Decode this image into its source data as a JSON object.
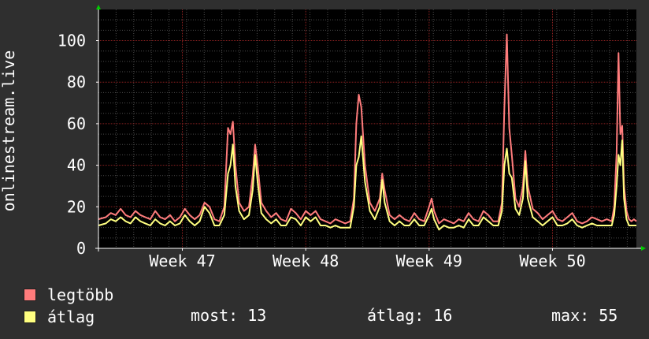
{
  "chart_data": {
    "type": "line",
    "ylabel": "onlinestream.live",
    "ylim": [
      0,
      115
    ],
    "yticks": [
      0,
      20,
      40,
      60,
      80,
      100
    ],
    "xlim": [
      46.32,
      50.68
    ],
    "xticks": [
      {
        "label": "Week 47",
        "x": 47
      },
      {
        "label": "Week 48",
        "x": 48
      },
      {
        "label": "Week 49",
        "x": 49
      },
      {
        "label": "Week 50",
        "x": 50
      }
    ],
    "grid": true,
    "series": [
      {
        "name": "legtöbb",
        "color": "#ff7c7c",
        "points": [
          [
            46.32,
            14
          ],
          [
            46.38,
            15
          ],
          [
            46.42,
            17
          ],
          [
            46.46,
            16
          ],
          [
            46.5,
            19
          ],
          [
            46.54,
            16
          ],
          [
            46.58,
            15
          ],
          [
            46.62,
            18
          ],
          [
            46.66,
            16
          ],
          [
            46.7,
            15
          ],
          [
            46.74,
            14
          ],
          [
            46.78,
            18
          ],
          [
            46.82,
            15
          ],
          [
            46.86,
            14
          ],
          [
            46.9,
            16
          ],
          [
            46.94,
            13
          ],
          [
            46.98,
            15
          ],
          [
            47.02,
            19
          ],
          [
            47.06,
            16
          ],
          [
            47.1,
            14
          ],
          [
            47.14,
            16
          ],
          [
            47.18,
            22
          ],
          [
            47.22,
            20
          ],
          [
            47.26,
            14
          ],
          [
            47.3,
            13
          ],
          [
            47.34,
            20
          ],
          [
            47.37,
            58
          ],
          [
            47.39,
            55
          ],
          [
            47.41,
            61
          ],
          [
            47.43,
            40
          ],
          [
            47.46,
            22
          ],
          [
            47.5,
            18
          ],
          [
            47.54,
            20
          ],
          [
            47.57,
            35
          ],
          [
            47.59,
            50
          ],
          [
            47.61,
            40
          ],
          [
            47.64,
            22
          ],
          [
            47.68,
            18
          ],
          [
            47.72,
            15
          ],
          [
            47.76,
            17
          ],
          [
            47.8,
            14
          ],
          [
            47.84,
            13
          ],
          [
            47.88,
            19
          ],
          [
            47.92,
            17
          ],
          [
            47.96,
            14
          ],
          [
            48.0,
            18
          ],
          [
            48.04,
            16
          ],
          [
            48.08,
            18
          ],
          [
            48.12,
            14
          ],
          [
            48.16,
            13
          ],
          [
            48.2,
            12
          ],
          [
            48.24,
            14
          ],
          [
            48.28,
            13
          ],
          [
            48.32,
            12
          ],
          [
            48.36,
            13
          ],
          [
            48.39,
            24
          ],
          [
            48.41,
            60
          ],
          [
            48.43,
            74
          ],
          [
            48.45,
            68
          ],
          [
            48.48,
            40
          ],
          [
            48.52,
            22
          ],
          [
            48.56,
            18
          ],
          [
            48.6,
            24
          ],
          [
            48.62,
            36
          ],
          [
            48.64,
            28
          ],
          [
            48.68,
            16
          ],
          [
            48.72,
            14
          ],
          [
            48.76,
            16
          ],
          [
            48.8,
            14
          ],
          [
            48.84,
            13
          ],
          [
            48.88,
            17
          ],
          [
            48.92,
            14
          ],
          [
            48.96,
            13
          ],
          [
            49.0,
            20
          ],
          [
            49.02,
            24
          ],
          [
            49.04,
            18
          ],
          [
            49.08,
            12
          ],
          [
            49.12,
            14
          ],
          [
            49.16,
            13
          ],
          [
            49.2,
            12
          ],
          [
            49.24,
            14
          ],
          [
            49.28,
            13
          ],
          [
            49.32,
            17
          ],
          [
            49.36,
            14
          ],
          [
            49.4,
            13
          ],
          [
            49.44,
            18
          ],
          [
            49.48,
            16
          ],
          [
            49.52,
            13
          ],
          [
            49.56,
            13
          ],
          [
            49.59,
            22
          ],
          [
            49.61,
            68
          ],
          [
            49.63,
            103
          ],
          [
            49.65,
            58
          ],
          [
            49.67,
            45
          ],
          [
            49.7,
            24
          ],
          [
            49.73,
            20
          ],
          [
            49.76,
            30
          ],
          [
            49.78,
            47
          ],
          [
            49.8,
            30
          ],
          [
            49.84,
            19
          ],
          [
            49.88,
            17
          ],
          [
            49.92,
            14
          ],
          [
            49.96,
            16
          ],
          [
            50.0,
            18
          ],
          [
            50.04,
            14
          ],
          [
            50.08,
            13
          ],
          [
            50.12,
            15
          ],
          [
            50.16,
            17
          ],
          [
            50.2,
            13
          ],
          [
            50.24,
            12
          ],
          [
            50.28,
            13
          ],
          [
            50.32,
            15
          ],
          [
            50.36,
            14
          ],
          [
            50.4,
            13
          ],
          [
            50.44,
            14
          ],
          [
            50.48,
            13
          ],
          [
            50.5,
            20
          ],
          [
            50.52,
            46
          ],
          [
            50.535,
            94
          ],
          [
            50.55,
            55
          ],
          [
            50.565,
            59
          ],
          [
            50.58,
            30
          ],
          [
            50.6,
            18
          ],
          [
            50.62,
            14
          ],
          [
            50.64,
            13
          ],
          [
            50.66,
            14
          ],
          [
            50.68,
            13
          ]
        ]
      },
      {
        "name": "átlag",
        "color": "#ffff80",
        "points": [
          [
            46.32,
            11
          ],
          [
            46.38,
            12
          ],
          [
            46.42,
            14
          ],
          [
            46.46,
            13
          ],
          [
            46.5,
            15
          ],
          [
            46.54,
            13
          ],
          [
            46.58,
            12
          ],
          [
            46.62,
            15
          ],
          [
            46.66,
            13
          ],
          [
            46.7,
            12
          ],
          [
            46.74,
            11
          ],
          [
            46.78,
            14
          ],
          [
            46.82,
            12
          ],
          [
            46.86,
            11
          ],
          [
            46.9,
            13
          ],
          [
            46.94,
            11
          ],
          [
            46.98,
            12
          ],
          [
            47.02,
            16
          ],
          [
            47.06,
            13
          ],
          [
            47.1,
            11
          ],
          [
            47.14,
            13
          ],
          [
            47.18,
            20
          ],
          [
            47.22,
            17
          ],
          [
            47.26,
            11
          ],
          [
            47.3,
            11
          ],
          [
            47.34,
            16
          ],
          [
            47.37,
            36
          ],
          [
            47.39,
            40
          ],
          [
            47.41,
            50
          ],
          [
            47.43,
            30
          ],
          [
            47.46,
            18
          ],
          [
            47.5,
            14
          ],
          [
            47.54,
            16
          ],
          [
            47.57,
            28
          ],
          [
            47.59,
            45
          ],
          [
            47.61,
            32
          ],
          [
            47.64,
            17
          ],
          [
            47.68,
            14
          ],
          [
            47.72,
            12
          ],
          [
            47.76,
            14
          ],
          [
            47.8,
            11
          ],
          [
            47.84,
            11
          ],
          [
            47.88,
            15
          ],
          [
            47.92,
            14
          ],
          [
            47.96,
            11
          ],
          [
            48.0,
            15
          ],
          [
            48.04,
            13
          ],
          [
            48.08,
            15
          ],
          [
            48.12,
            11
          ],
          [
            48.16,
            11
          ],
          [
            48.2,
            10
          ],
          [
            48.24,
            11
          ],
          [
            48.28,
            10
          ],
          [
            48.32,
            10
          ],
          [
            48.36,
            10
          ],
          [
            48.39,
            20
          ],
          [
            48.41,
            40
          ],
          [
            48.43,
            44
          ],
          [
            48.45,
            54
          ],
          [
            48.48,
            32
          ],
          [
            48.52,
            18
          ],
          [
            48.56,
            14
          ],
          [
            48.6,
            20
          ],
          [
            48.62,
            33
          ],
          [
            48.64,
            22
          ],
          [
            48.68,
            13
          ],
          [
            48.72,
            11
          ],
          [
            48.76,
            13
          ],
          [
            48.8,
            11
          ],
          [
            48.84,
            11
          ],
          [
            48.88,
            14
          ],
          [
            48.92,
            11
          ],
          [
            48.96,
            11
          ],
          [
            49.0,
            16
          ],
          [
            49.02,
            19
          ],
          [
            49.04,
            14
          ],
          [
            49.08,
            9
          ],
          [
            49.12,
            11
          ],
          [
            49.16,
            10
          ],
          [
            49.2,
            10
          ],
          [
            49.24,
            11
          ],
          [
            49.28,
            10
          ],
          [
            49.32,
            14
          ],
          [
            49.36,
            11
          ],
          [
            49.4,
            11
          ],
          [
            49.44,
            15
          ],
          [
            49.48,
            13
          ],
          [
            49.52,
            11
          ],
          [
            49.56,
            11
          ],
          [
            49.59,
            18
          ],
          [
            49.61,
            40
          ],
          [
            49.63,
            48
          ],
          [
            49.65,
            36
          ],
          [
            49.67,
            34
          ],
          [
            49.7,
            19
          ],
          [
            49.73,
            16
          ],
          [
            49.76,
            24
          ],
          [
            49.78,
            42
          ],
          [
            49.8,
            24
          ],
          [
            49.84,
            15
          ],
          [
            49.88,
            13
          ],
          [
            49.92,
            11
          ],
          [
            49.96,
            13
          ],
          [
            50.0,
            15
          ],
          [
            50.04,
            11
          ],
          [
            50.08,
            11
          ],
          [
            50.12,
            12
          ],
          [
            50.16,
            14
          ],
          [
            50.2,
            11
          ],
          [
            50.24,
            10
          ],
          [
            50.28,
            11
          ],
          [
            50.32,
            12
          ],
          [
            50.36,
            11
          ],
          [
            50.4,
            11
          ],
          [
            50.44,
            11
          ],
          [
            50.48,
            11
          ],
          [
            50.5,
            16
          ],
          [
            50.52,
            30
          ],
          [
            50.535,
            45
          ],
          [
            50.55,
            40
          ],
          [
            50.565,
            52
          ],
          [
            50.58,
            24
          ],
          [
            50.6,
            14
          ],
          [
            50.62,
            11
          ],
          [
            50.64,
            11
          ],
          [
            50.66,
            11
          ],
          [
            50.68,
            11
          ]
        ]
      }
    ],
    "legend": {
      "placement": "bottom-left",
      "entries": [
        {
          "label": "legtöbb",
          "color": "#ff7c7c"
        },
        {
          "label": "átlag",
          "color": "#ffff80"
        }
      ],
      "stats": {
        "now": "most: 13",
        "avg": "átlag: 16",
        "max": "max: 55"
      }
    },
    "colors": {
      "background": "#2f2f2f",
      "plot_bg": "#000000",
      "grid_major": "#8a2020",
      "grid_minor": "#4a4a4a",
      "axis": "#ffffff",
      "arrow": "#00cc00"
    }
  }
}
